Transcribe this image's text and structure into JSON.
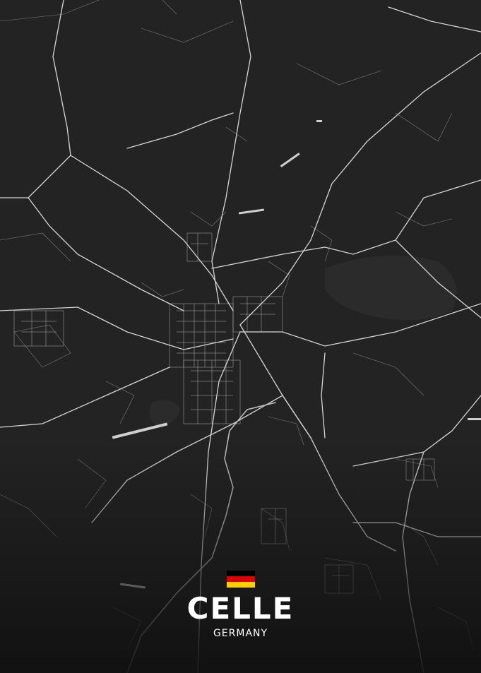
{
  "poster": {
    "city": "CELLE",
    "country": "GERMANY",
    "flag": {
      "icon": "germany-flag-icon",
      "colors": [
        "#000000",
        "#dd0000",
        "#ffce00"
      ]
    }
  },
  "colors": {
    "background": "#232323",
    "major_road": "#d8d8d8",
    "minor_road": "#9a9a9a",
    "water": "#2c2c2c",
    "text": "#ffffff"
  }
}
